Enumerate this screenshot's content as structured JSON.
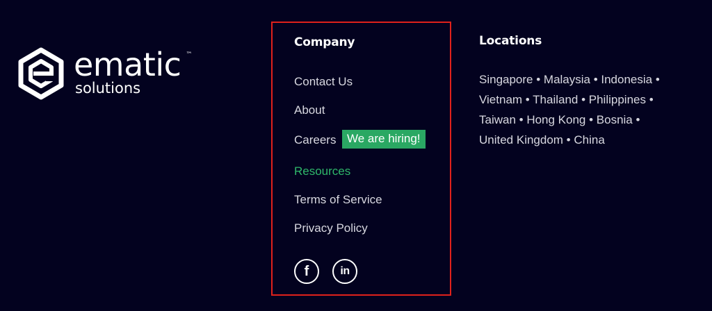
{
  "brand": {
    "name": "ematic",
    "subtitle": "solutions",
    "trademark": "™",
    "logo_icon": "ematic-hexagon-logo-icon"
  },
  "company": {
    "heading": "Company",
    "links": [
      {
        "label": "Contact Us"
      },
      {
        "label": "About"
      },
      {
        "label": "Careers"
      },
      {
        "label": "Resources",
        "active": true
      },
      {
        "label": "Terms of Service"
      },
      {
        "label": "Privacy Policy"
      }
    ],
    "hiring_badge": "We are hiring!",
    "social": [
      {
        "icon": "facebook-icon",
        "glyph": "f"
      },
      {
        "icon": "linkedin-icon",
        "glyph": "in"
      }
    ]
  },
  "locations": {
    "heading": "Locations",
    "text": "Singapore • Malaysia • Indonesia • Vietnam • Thailand • Philippines • Taiwan • Hong Kong • Bosnia • United Kingdom • China"
  },
  "colors": {
    "background": "#03021f",
    "accent_green": "#2aa863",
    "highlight_border": "#e0211b",
    "text": "#d8d8e0"
  }
}
